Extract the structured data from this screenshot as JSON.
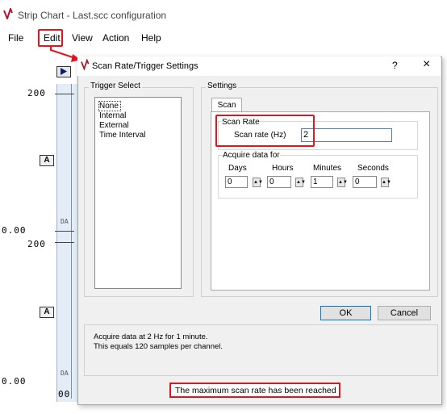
{
  "app": {
    "title": "Strip Chart - Last.scc configuration"
  },
  "menu": {
    "file": "File",
    "edit": "Edit",
    "view": "View",
    "action": "Action",
    "help": "Help"
  },
  "chart": {
    "y_top_1": "200",
    "y_bottom_1": "0.00",
    "y_top_2": "200",
    "y_bottom_2": "0.00",
    "button_a": "A",
    "da_label": "DA",
    "x_tick": "00"
  },
  "dialog": {
    "title": "Scan Rate/Trigger Settings",
    "help_glyph": "?",
    "close_glyph": "×",
    "trigger_group": "Trigger Select",
    "trigger_options": [
      "None",
      "Internal",
      "External",
      "Time Interval"
    ],
    "trigger_selected": "None",
    "settings_group": "Settings",
    "tab": "Scan",
    "scan_rate_group": "Scan Rate",
    "scan_rate_label": "Scan rate (Hz)",
    "scan_rate_value": "2",
    "acquire_group": "Acquire data for",
    "acquire_fields": [
      {
        "label": "Days",
        "value": "0"
      },
      {
        "label": "Hours",
        "value": "0"
      },
      {
        "label": "Minutes",
        "value": "1"
      },
      {
        "label": "Seconds",
        "value": "0"
      }
    ],
    "ok": "OK",
    "cancel": "Cancel",
    "summary_line1": "Acquire data at 2 Hz for 1 minute.",
    "summary_line2": "This equals 120 samples per channel.",
    "status": "The maximum scan rate has been reached"
  },
  "colors": {
    "highlight": "#e3151c",
    "logo": "#b3142c"
  }
}
